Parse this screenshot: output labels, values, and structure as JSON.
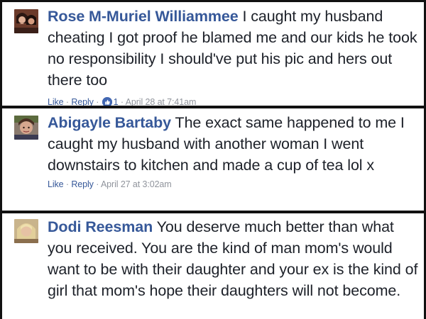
{
  "comments": [
    {
      "author": "Rose M-Muriel Williammee",
      "text": "I caught my husband cheating I got proof he blamed me and our kids he took no responsibility I should've put his pic and hers out there too",
      "like_label": "Like",
      "reply_label": "Reply",
      "reaction_count": "1",
      "timestamp": "April 28 at 7:41am",
      "avatar_icon": "profile-photo"
    },
    {
      "author": "Abigayle Bartaby",
      "text": "The exact same happened to me I caught my husband with another woman I went downstairs to kitchen and made a cup of tea lol x",
      "like_label": "Like",
      "reply_label": "Reply",
      "timestamp": "April 27 at 3:02am",
      "avatar_icon": "profile-photo"
    },
    {
      "author": "Dodi Reesman",
      "text": "You deserve much better than what you received. You are the kind of man mom's would want to be with their daughter and your ex is the kind of girl that mom's hope their daughters will not become.",
      "avatar_icon": "profile-photo"
    }
  ],
  "colors": {
    "author": "#365899",
    "body_text": "#1d2129",
    "meta_text": "#90949c",
    "like_icon": "#4267b2",
    "divider": "#111111"
  }
}
